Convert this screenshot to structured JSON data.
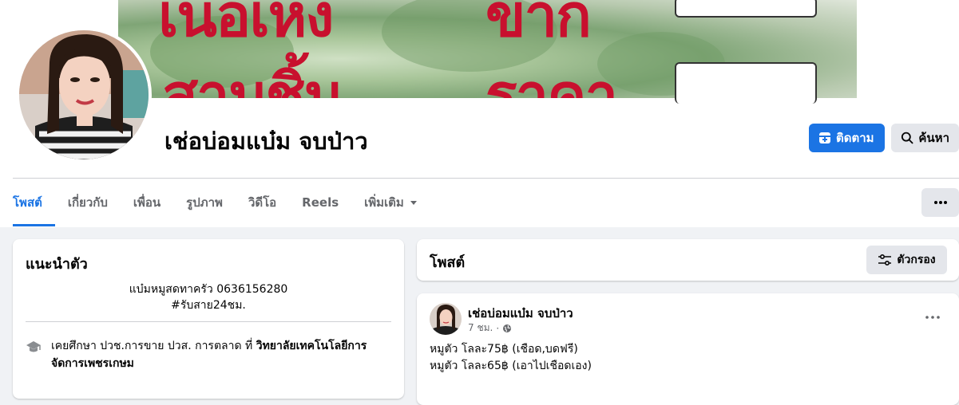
{
  "cover": {
    "line1_left": "เนอเหง",
    "line1_right": "ขาก",
    "line2_left": "สามชิ้น",
    "line2_right": "ราคา"
  },
  "page": {
    "name": "เช่อบ่อมแบ๋ม จบป่าว"
  },
  "actions": {
    "follow_label": "ติดตาม",
    "search_label": "ค้นหา"
  },
  "tabs": [
    {
      "label": "โพสต์",
      "active": true
    },
    {
      "label": "เกี่ยวกับ",
      "active": false
    },
    {
      "label": "เพื่อน",
      "active": false
    },
    {
      "label": "รูปภาพ",
      "active": false
    },
    {
      "label": "วิดีโอ",
      "active": false
    },
    {
      "label": "Reels",
      "active": false
    },
    {
      "label": "เพิ่มเติม",
      "active": false
    }
  ],
  "intro": {
    "title": "แนะนำตัว",
    "bio_line1": "แบ๋มหมูสดทาครัว 0636156280",
    "bio_line2": "#รับสาย24ชม.",
    "edu_prefix": "เคยศึกษา ปวช.การขาย ปวส. การตลาด ที่ ",
    "edu_school": "วิทยาลัยเทคโนโลยีการจัดการเพชรเกษม"
  },
  "posts": {
    "title": "โพสต์",
    "filter_label": "ตัวกรอง"
  },
  "post": {
    "author": "เช่อบ่อมแบ๋ม จบป่าว",
    "time": "7 ชม.",
    "separator": "·",
    "line1": "หมูตัว โลละ75฿ (เชือด,บดฟรี)",
    "line2": "หมูตัว โลละ65฿ (เอาไปเชือดเอง)"
  },
  "colors": {
    "accent": "#1b74e4",
    "background": "#f0f2f5",
    "secondary_text": "#65676b"
  }
}
